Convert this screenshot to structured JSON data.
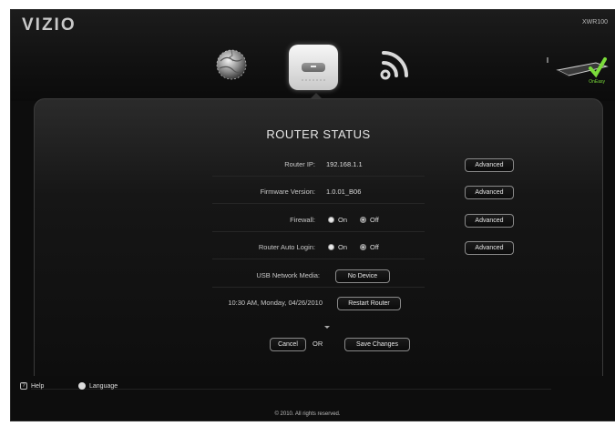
{
  "header": {
    "logo": "VIZIO",
    "model": "XWR100",
    "status_text": "OnEasy"
  },
  "nav": {
    "icons": [
      "globe-icon",
      "router-icon",
      "wifi-icon"
    ],
    "active": "router-icon"
  },
  "panel": {
    "title": "ROUTER STATUS",
    "rows": [
      {
        "label": "Router IP:",
        "value": "192.168.1.1",
        "button": "Advanced"
      },
      {
        "label": "Firmware Version:",
        "value": "1.0.01_B06",
        "button": "Advanced"
      },
      {
        "label": "Firewall:",
        "on_label": "On",
        "off_label": "Off",
        "selected": "On",
        "button": "Advanced"
      },
      {
        "label": "Router Auto Login:",
        "on_label": "On",
        "off_label": "Off",
        "selected": "On",
        "button": "Advanced"
      },
      {
        "label": "USB Network Media:",
        "button": "No Device"
      },
      {
        "label": "10:30 AM, Monday, 04/26/2010",
        "button": "Restart Router"
      }
    ],
    "cancel_label": "Cancel",
    "or_label": "OR",
    "save_label": "Save Changes"
  },
  "footer": {
    "help_label": "Help",
    "language_label": "Language",
    "copyright": "© 2010. All rights reserved."
  },
  "colors": {
    "accent_green": "#7bdc3a",
    "background": "#0d0d0d"
  }
}
